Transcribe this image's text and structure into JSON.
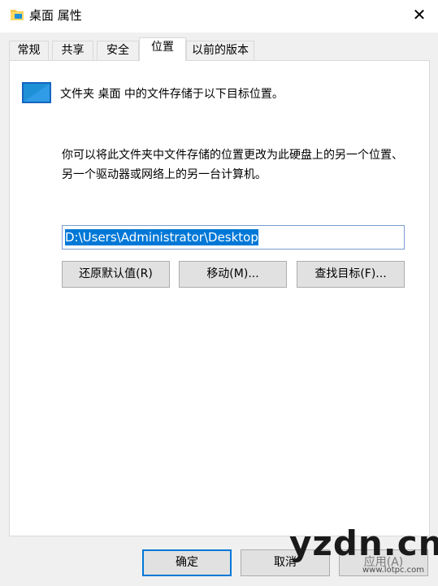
{
  "window": {
    "title": "桌面 属性",
    "title_icon": "folder-icon",
    "close_glyph": "✕"
  },
  "tabs": [
    {
      "label": "常规",
      "active": false
    },
    {
      "label": "共享",
      "active": false
    },
    {
      "label": "安全",
      "active": false
    },
    {
      "label": "位置",
      "active": true
    },
    {
      "label": "以前的版本",
      "active": false
    }
  ],
  "location": {
    "heading": "文件夹 桌面 中的文件存储于以下目标位置。",
    "description": "你可以将此文件夹中文件存储的位置更改为此硬盘上的另一个位置、另一个驱动器或网络上的另一台计算机。",
    "path_value": "D:\\Users\\Administrator\\Desktop",
    "restore_default_label": "还原默认值(R)",
    "move_label": "移动(M)...",
    "find_target_label": "查找目标(F)..."
  },
  "footer": {
    "ok_label": "确定",
    "cancel_label": "取消",
    "apply_label": "应用(A)"
  },
  "watermark": {
    "text": "yzdn.cn",
    "small": "www.lotpc.com"
  },
  "colors": {
    "accent": "#0078d7",
    "folder_blue": "#1e90d6",
    "folder_yellow": "#f2c84b"
  }
}
